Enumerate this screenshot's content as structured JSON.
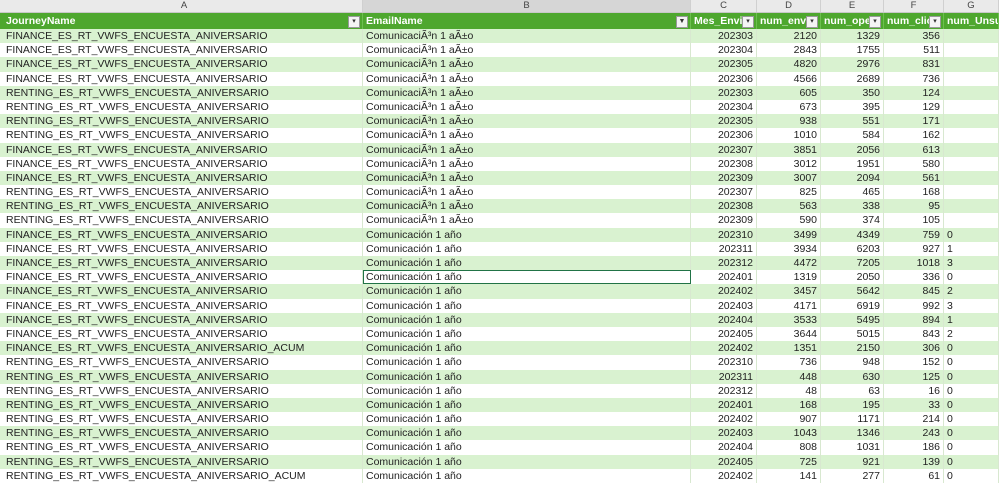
{
  "column_letters": [
    "A",
    "B",
    "C",
    "D",
    "E",
    "F",
    "G"
  ],
  "headers": [
    "JourneyName",
    "EmailName",
    "Mes_Envio",
    "num_envio",
    "num_open",
    "num_click",
    "num_Unsub"
  ],
  "rows": [
    [
      "FINANCE_ES_RT_VWFS_ENCUESTA_ANIVERSARIO",
      "ComunicaciÃ³n 1 aÃ±o",
      "202303",
      "2120",
      "1329",
      "356",
      ""
    ],
    [
      "FINANCE_ES_RT_VWFS_ENCUESTA_ANIVERSARIO",
      "ComunicaciÃ³n 1 aÃ±o",
      "202304",
      "2843",
      "1755",
      "511",
      ""
    ],
    [
      "FINANCE_ES_RT_VWFS_ENCUESTA_ANIVERSARIO",
      "ComunicaciÃ³n 1 aÃ±o",
      "202305",
      "4820",
      "2976",
      "831",
      ""
    ],
    [
      "FINANCE_ES_RT_VWFS_ENCUESTA_ANIVERSARIO",
      "ComunicaciÃ³n 1 aÃ±o",
      "202306",
      "4566",
      "2689",
      "736",
      ""
    ],
    [
      "RENTING_ES_RT_VWFS_ENCUESTA_ANIVERSARIO",
      "ComunicaciÃ³n 1 aÃ±o",
      "202303",
      "605",
      "350",
      "124",
      ""
    ],
    [
      "RENTING_ES_RT_VWFS_ENCUESTA_ANIVERSARIO",
      "ComunicaciÃ³n 1 aÃ±o",
      "202304",
      "673",
      "395",
      "129",
      ""
    ],
    [
      "RENTING_ES_RT_VWFS_ENCUESTA_ANIVERSARIO",
      "ComunicaciÃ³n 1 aÃ±o",
      "202305",
      "938",
      "551",
      "171",
      ""
    ],
    [
      "RENTING_ES_RT_VWFS_ENCUESTA_ANIVERSARIO",
      "ComunicaciÃ³n 1 aÃ±o",
      "202306",
      "1010",
      "584",
      "162",
      ""
    ],
    [
      "FINANCE_ES_RT_VWFS_ENCUESTA_ANIVERSARIO",
      "ComunicaciÃ³n 1 aÃ±o",
      "202307",
      "3851",
      "2056",
      "613",
      ""
    ],
    [
      "FINANCE_ES_RT_VWFS_ENCUESTA_ANIVERSARIO",
      "ComunicaciÃ³n 1 aÃ±o",
      "202308",
      "3012",
      "1951",
      "580",
      ""
    ],
    [
      "FINANCE_ES_RT_VWFS_ENCUESTA_ANIVERSARIO",
      "ComunicaciÃ³n 1 aÃ±o",
      "202309",
      "3007",
      "2094",
      "561",
      ""
    ],
    [
      "RENTING_ES_RT_VWFS_ENCUESTA_ANIVERSARIO",
      "ComunicaciÃ³n 1 aÃ±o",
      "202307",
      "825",
      "465",
      "168",
      ""
    ],
    [
      "RENTING_ES_RT_VWFS_ENCUESTA_ANIVERSARIO",
      "ComunicaciÃ³n 1 aÃ±o",
      "202308",
      "563",
      "338",
      "95",
      ""
    ],
    [
      "RENTING_ES_RT_VWFS_ENCUESTA_ANIVERSARIO",
      "ComunicaciÃ³n 1 aÃ±o",
      "202309",
      "590",
      "374",
      "105",
      ""
    ],
    [
      "FINANCE_ES_RT_VWFS_ENCUESTA_ANIVERSARIO",
      "Comunicación 1 año",
      "202310",
      "3499",
      "4349",
      "759",
      "0"
    ],
    [
      "FINANCE_ES_RT_VWFS_ENCUESTA_ANIVERSARIO",
      "Comunicación 1 año",
      "202311",
      "3934",
      "6203",
      "927",
      "1"
    ],
    [
      "FINANCE_ES_RT_VWFS_ENCUESTA_ANIVERSARIO",
      "Comunicación 1 año",
      "202312",
      "4472",
      "7205",
      "1018",
      "3"
    ],
    [
      "FINANCE_ES_RT_VWFS_ENCUESTA_ANIVERSARIO",
      "Comunicación 1 año",
      "202401",
      "1319",
      "2050",
      "336",
      "0"
    ],
    [
      "FINANCE_ES_RT_VWFS_ENCUESTA_ANIVERSARIO",
      "Comunicación 1 año",
      "202402",
      "3457",
      "5642",
      "845",
      "2"
    ],
    [
      "FINANCE_ES_RT_VWFS_ENCUESTA_ANIVERSARIO",
      "Comunicación 1 año",
      "202403",
      "4171",
      "6919",
      "992",
      "3"
    ],
    [
      "FINANCE_ES_RT_VWFS_ENCUESTA_ANIVERSARIO",
      "Comunicación 1 año",
      "202404",
      "3533",
      "5495",
      "894",
      "1"
    ],
    [
      "FINANCE_ES_RT_VWFS_ENCUESTA_ANIVERSARIO",
      "Comunicación 1 año",
      "202405",
      "3644",
      "5015",
      "843",
      "2"
    ],
    [
      "FINANCE_ES_RT_VWFS_ENCUESTA_ANIVERSARIO_ACUM",
      "Comunicación 1 año",
      "202402",
      "1351",
      "2150",
      "306",
      "0"
    ],
    [
      "RENTING_ES_RT_VWFS_ENCUESTA_ANIVERSARIO",
      "Comunicación 1 año",
      "202310",
      "736",
      "948",
      "152",
      "0"
    ],
    [
      "RENTING_ES_RT_VWFS_ENCUESTA_ANIVERSARIO",
      "Comunicación 1 año",
      "202311",
      "448",
      "630",
      "125",
      "0"
    ],
    [
      "RENTING_ES_RT_VWFS_ENCUESTA_ANIVERSARIO",
      "Comunicación 1 año",
      "202312",
      "48",
      "63",
      "16",
      "0"
    ],
    [
      "RENTING_ES_RT_VWFS_ENCUESTA_ANIVERSARIO",
      "Comunicación 1 año",
      "202401",
      "168",
      "195",
      "33",
      "0"
    ],
    [
      "RENTING_ES_RT_VWFS_ENCUESTA_ANIVERSARIO",
      "Comunicación 1 año",
      "202402",
      "907",
      "1171",
      "214",
      "0"
    ],
    [
      "RENTING_ES_RT_VWFS_ENCUESTA_ANIVERSARIO",
      "Comunicación 1 año",
      "202403",
      "1043",
      "1346",
      "243",
      "0"
    ],
    [
      "RENTING_ES_RT_VWFS_ENCUESTA_ANIVERSARIO",
      "Comunicación 1 año",
      "202404",
      "808",
      "1031",
      "186",
      "0"
    ],
    [
      "RENTING_ES_RT_VWFS_ENCUESTA_ANIVERSARIO",
      "Comunicación 1 año",
      "202405",
      "725",
      "921",
      "139",
      "0"
    ],
    [
      "RENTING_ES_RT_VWFS_ENCUESTA_ANIVERSARIO_ACUM",
      "Comunicación 1 año",
      "202402",
      "141",
      "277",
      "61",
      "0"
    ]
  ],
  "selected": {
    "row": 17,
    "col": 1
  },
  "filtered_column": 1,
  "colors": {
    "header": "#4ea72e",
    "band": "#d9f2d0"
  }
}
